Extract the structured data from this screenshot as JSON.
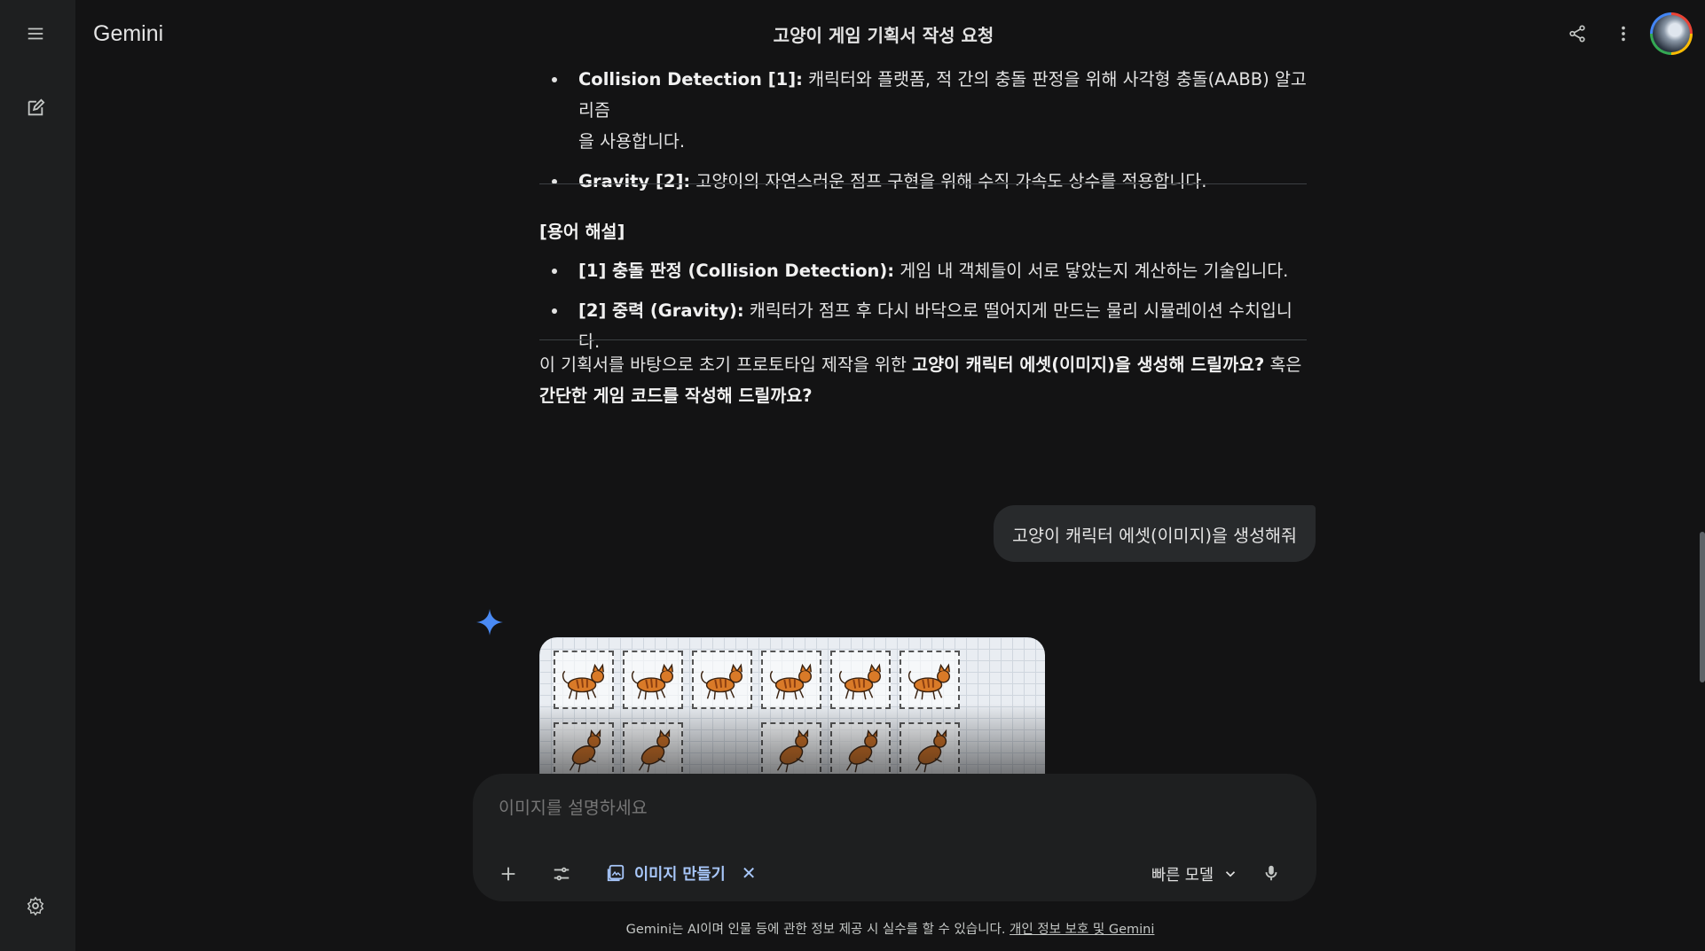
{
  "app": {
    "brand": "Gemini",
    "conversation_title": "고양이 게임 기획서 작성 요청"
  },
  "sidebar": {
    "menu_icon": "menu-icon",
    "new_chat_icon": "edit-icon",
    "settings_icon": "gear-icon"
  },
  "header": {
    "share_icon": "share-icon",
    "more_icon": "more-vert-icon"
  },
  "response": {
    "top_bullets": [
      {
        "term": "Collision Detection [1]:",
        "text_line1": " 캐릭터와 플랫폼, 적 간의 충돌 판정을 위해 사각형 충돌(AABB) 알고리즘",
        "text_line2": "을 사용합니다."
      },
      {
        "term": "Gravity [2]:",
        "text": " 고양이의 자연스러운 점프 구현을 위해 수직 가속도 상수를 적용합니다."
      }
    ],
    "glossary_title": "[용어 해설]",
    "glossary": [
      {
        "term": "[1] 충돌 판정 (Collision Detection):",
        "text": " 게임 내 객체들이 서로 닿았는지 계산하는 기술입니다."
      },
      {
        "term": "[2] 중력 (Gravity):",
        "text": " 캐릭터가 점프 후 다시 바닥으로 떨어지게 만드는 물리 시뮬레이션 수치입니다."
      }
    ],
    "closing": {
      "part1": "이 기획서를 바탕으로 초기 프로토타입 제작을 위한 ",
      "bold1": "고양이 캐릭터 에셋(이미지)을 생성해 드릴까요?",
      "part2": " 혹은",
      "bold2": "간단한 게임 코드를 작성해 드릴까요?"
    }
  },
  "user_message": "고양이 캐릭터 에셋(이미지)을 생성해줘",
  "generated_image": {
    "kind": "cat-sprite-sheet"
  },
  "prompt": {
    "placeholder": "이미지를 설명하세요",
    "add_icon": "plus-icon",
    "tools_icon": "tune-icon",
    "chip_label": "이미지 만들기",
    "chip_icon": "image-create-icon",
    "chip_close": "✕",
    "model_label": "빠른 모델",
    "mic_icon": "mic-icon"
  },
  "footer": {
    "disclaimer": "Gemini는 AI이며 인물 등에 관한 정보 제공 시 실수를 할 수 있습니다. ",
    "link": "개인 정보 보호 및 Gemini"
  },
  "colors": {
    "background": "#131314",
    "sidebar": "#1e1f20",
    "text": "#e3e3e3",
    "accent": "#a8c7fa",
    "sparkle": "#4a8af4"
  }
}
